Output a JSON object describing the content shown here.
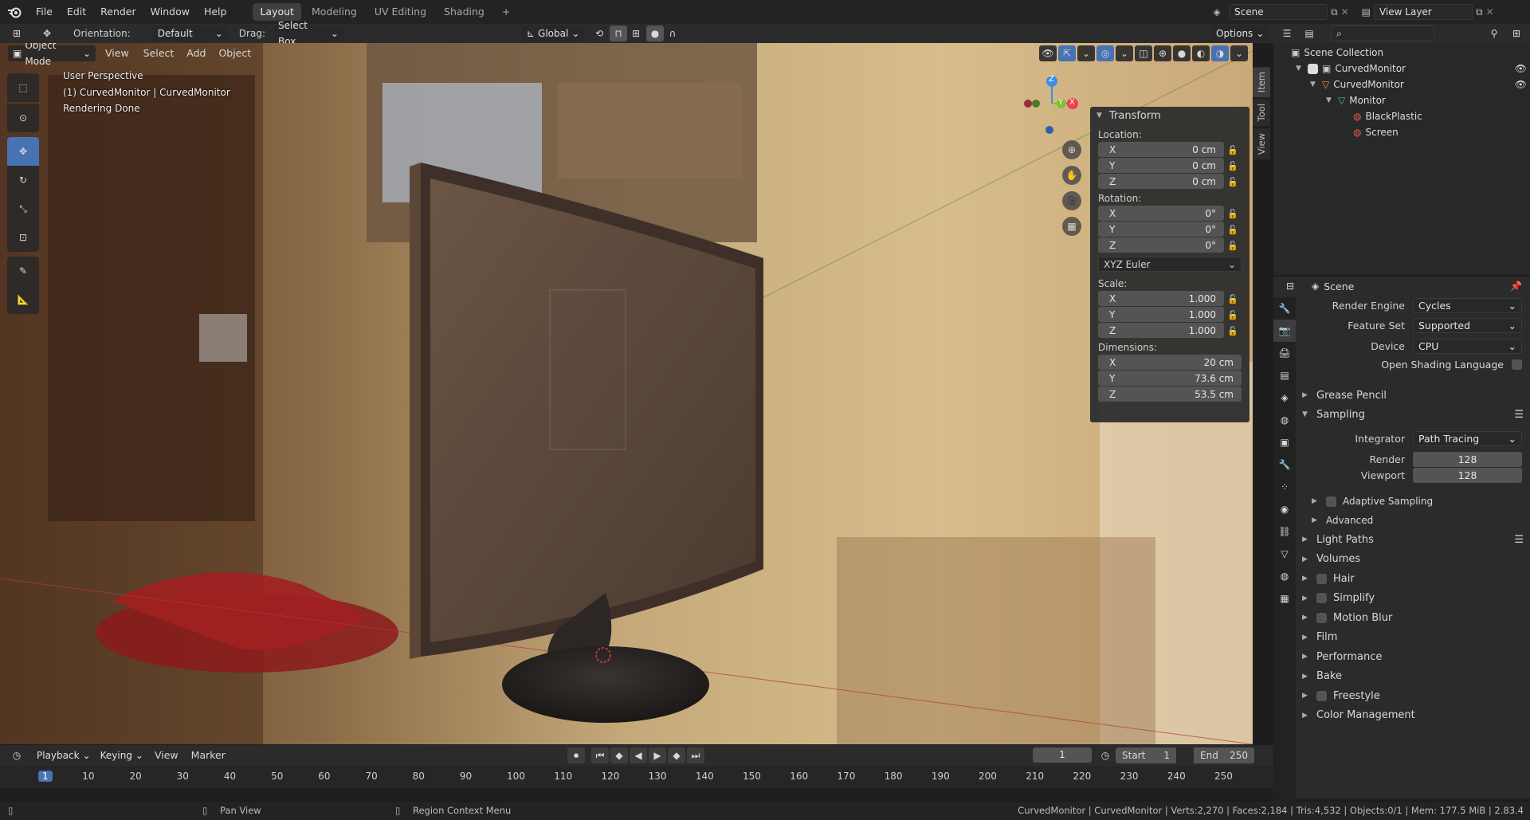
{
  "menubar": {
    "items": [
      "File",
      "Edit",
      "Render",
      "Window",
      "Help"
    ],
    "workspaces": [
      "Layout",
      "Modeling",
      "UV Editing",
      "Shading"
    ],
    "active_workspace": "Layout",
    "scene_name": "Scene",
    "view_layer": "View Layer"
  },
  "tool_header": {
    "orientation_label": "Orientation:",
    "orientation_value": "Default",
    "drag_label": "Drag:",
    "drag_value": "Select Box",
    "transform_orientation": "Global",
    "options": "Options"
  },
  "viewport_header": {
    "mode": "Object Mode",
    "menus": [
      "View",
      "Select",
      "Add",
      "Object"
    ]
  },
  "viewport_info": {
    "view_name": "User Perspective",
    "object_line": "(1) CurvedMonitor | CurvedMonitor",
    "status": "Rendering Done"
  },
  "gizmo": {
    "z": "Z",
    "y": "Y",
    "x": "X"
  },
  "side_tabs": [
    "Item",
    "Tool",
    "View"
  ],
  "transform_panel": {
    "title": "Transform",
    "location_label": "Location:",
    "location": [
      {
        "axis": "X",
        "value": "0 cm"
      },
      {
        "axis": "Y",
        "value": "0 cm"
      },
      {
        "axis": "Z",
        "value": "0 cm"
      }
    ],
    "rotation_label": "Rotation:",
    "rotation": [
      {
        "axis": "X",
        "value": "0°"
      },
      {
        "axis": "Y",
        "value": "0°"
      },
      {
        "axis": "Z",
        "value": "0°"
      }
    ],
    "rotation_mode": "XYZ Euler",
    "scale_label": "Scale:",
    "scale": [
      {
        "axis": "X",
        "value": "1.000"
      },
      {
        "axis": "Y",
        "value": "1.000"
      },
      {
        "axis": "Z",
        "value": "1.000"
      }
    ],
    "dimensions_label": "Dimensions:",
    "dimensions": [
      {
        "axis": "X",
        "value": "20 cm"
      },
      {
        "axis": "Y",
        "value": "73.6 cm"
      },
      {
        "axis": "Z",
        "value": "53.5 cm"
      }
    ]
  },
  "outliner": {
    "root": "Scene Collection",
    "items": [
      {
        "label": "CurvedMonitor",
        "kind": "collection"
      },
      {
        "label": "CurvedMonitor",
        "kind": "object"
      },
      {
        "label": "Monitor",
        "kind": "mesh"
      },
      {
        "label": "BlackPlastic",
        "kind": "material"
      },
      {
        "label": "Screen",
        "kind": "material"
      }
    ]
  },
  "properties": {
    "context": "Scene",
    "render_engine_label": "Render Engine",
    "render_engine": "Cycles",
    "feature_set_label": "Feature Set",
    "feature_set": "Supported",
    "device_label": "Device",
    "device": "CPU",
    "osl_label": "Open Shading Language",
    "grease_pencil": "Grease Pencil",
    "sampling": "Sampling",
    "integrator_label": "Integrator",
    "integrator": "Path Tracing",
    "render_label": "Render",
    "render_samples": "128",
    "viewport_label": "Viewport",
    "viewport_samples": "128",
    "adaptive_sampling": "Adaptive Sampling",
    "advanced": "Advanced",
    "sections": [
      "Light Paths",
      "Volumes",
      "Hair",
      "Simplify",
      "Motion Blur",
      "Film",
      "Performance",
      "Bake",
      "Freestyle",
      "Color Management"
    ]
  },
  "timeline": {
    "menus": [
      "Playback",
      "Keying",
      "View",
      "Marker"
    ],
    "current_frame": "1",
    "start_label": "Start",
    "start": "1",
    "end_label": "End",
    "end": "250",
    "ticks": [
      "1",
      "10",
      "20",
      "30",
      "40",
      "50",
      "60",
      "70",
      "80",
      "90",
      "100",
      "110",
      "120",
      "130",
      "140",
      "150",
      "160",
      "170",
      "180",
      "190",
      "200",
      "210",
      "220",
      "230",
      "240",
      "250"
    ]
  },
  "statusbar": {
    "pan_view": "Pan View",
    "context_menu": "Region Context Menu",
    "stats": "CurvedMonitor | CurvedMonitor | Verts:2,270 | Faces:2,184 | Tris:4,532 | Objects:0/1 | Mem: 177.5 MiB | 2.83.4"
  },
  "colors": {
    "accent": "#4772b3",
    "x_axis": "#e8414e",
    "y_axis": "#7ec033",
    "z_axis": "#3b8ee4"
  }
}
